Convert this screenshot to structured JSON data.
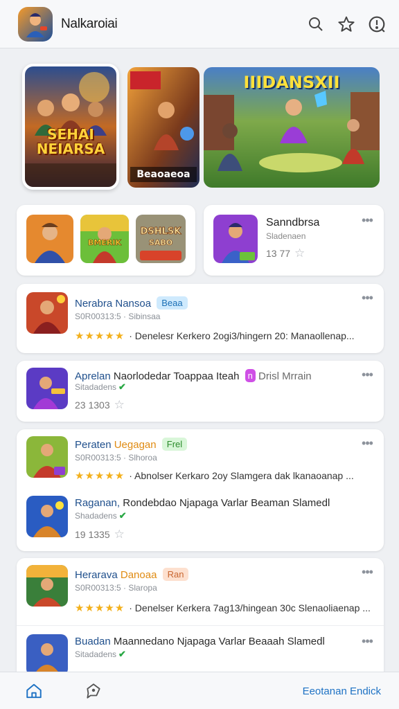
{
  "header": {
    "app_title": "Nalkaroiai",
    "icons": [
      "search-icon",
      "star-icon",
      "info-icon"
    ]
  },
  "banners": [
    {
      "title": "SEHAI NEIARSA",
      "caption": ""
    },
    {
      "title": "",
      "caption": "Beaoaeoa"
    },
    {
      "title": "IIIDANSXII",
      "caption": ""
    }
  ],
  "featured": {
    "title": "Sanndbrsa",
    "subtitle": "Sladenaen",
    "rating": "13 77"
  },
  "rows": [
    {
      "title": "Nerabra",
      "title_rest": "Nansoa",
      "tag": "Beaa",
      "sub": "S0R00313:5 · Sibinsaa",
      "stars": "★★★★★",
      "desc": "· Denelesr Kerkero 2ogi3/hingern 20: Manaollenap..."
    },
    {
      "title": "Aprelan",
      "title_rest": "Naorlodedar Toappaa Iteah",
      "tag": "n",
      "tag_suffix": "Drisl Mrrain",
      "sub": "Sitadadens",
      "rating": "23 1303"
    },
    {
      "title": "Peraten",
      "title_rest": "Uegagan",
      "tag": "Frel",
      "sub": "S0R00313:5 · Slhoroa",
      "stars": "★★★★★",
      "desc": "· Abnolser Kerkaro 2oy Slamgera dak lkanaoanap ..."
    },
    {
      "title": "Raganan,",
      "title_rest": "Rondebdao Njapaga Varlar Beaman Slamedl",
      "sub": "Shadadens",
      "rating": "19 1335"
    },
    {
      "title": "Herarava",
      "title_rest": "Danoaa",
      "tag": "Ran",
      "sub": "S0R00313:5 · Slaropa",
      "stars": "★★★★★",
      "desc": "· Denelser Kerkera 7ag13/hingean 30c Slenaoliaenap ..."
    },
    {
      "title": "Buadan",
      "title_rest": "Maannedano Njapaga Varlar Beaaah Slamedl",
      "sub": "Sitadadens"
    }
  ],
  "bottom_nav": {
    "link": "Eeotanan Endick",
    "icons": [
      "home-icon",
      "chat-icon"
    ]
  },
  "colors": {
    "accent": "#1e72c4",
    "star": "#f3b01b",
    "check": "#2aa845"
  }
}
